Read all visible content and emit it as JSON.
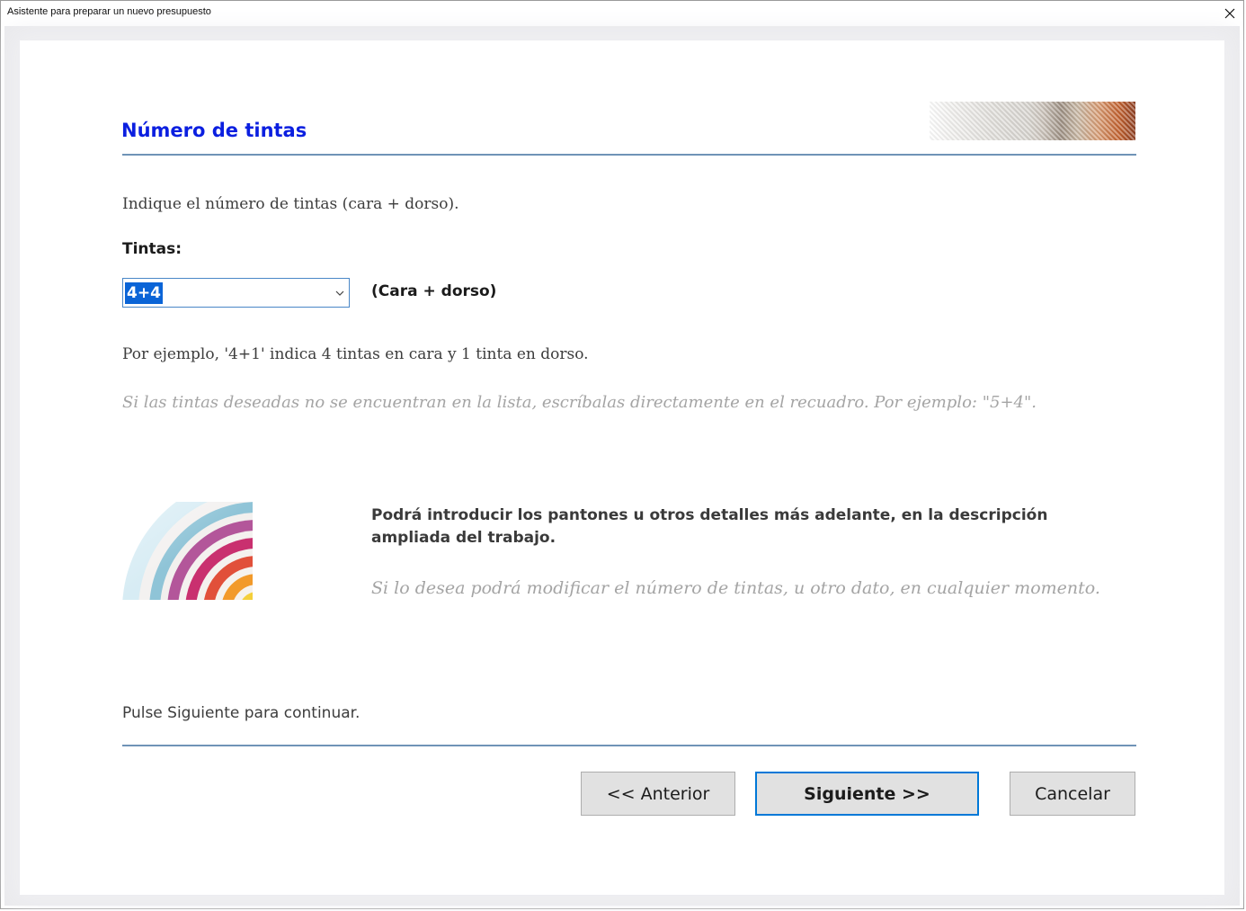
{
  "window": {
    "title": "Asistente para preparar un nuevo presupuesto",
    "close_icon": "close-icon"
  },
  "header": {
    "title": "Número de tintas"
  },
  "main": {
    "instruction": "Indique el número de tintas (cara + dorso).",
    "tintas_label": "Tintas:",
    "tintas_value": "4+4",
    "tintas_suffix": "(Cara + dorso)",
    "example": "Por ejemplo, '4+1' indica 4 tintas en cara y 1 tinta en dorso.",
    "hint": "Si las tintas deseadas no se encuentran en la lista, escríbalas directamente en el recuadro. Por ejemplo: \"5+4\".",
    "pantone_note": "Podrá introducir los pantones u otros detalles más adelante, en la descripción ampliada del trabajo.",
    "modify_note": "Si lo desea podrá modificar el número de tintas, u otro dato, en cualquier momento.",
    "continue_text": "Pulse Siguiente para continuar."
  },
  "footer": {
    "prev_label": "<< Anterior",
    "next_label": "Siguiente >>",
    "cancel_label": "Cancelar"
  },
  "colors": {
    "heading": "#0b1fe0",
    "rule": "#6f93b7",
    "selection": "#0a64d7",
    "default_button_border": "#0078d7",
    "hint_text": "#a4a4a4"
  }
}
